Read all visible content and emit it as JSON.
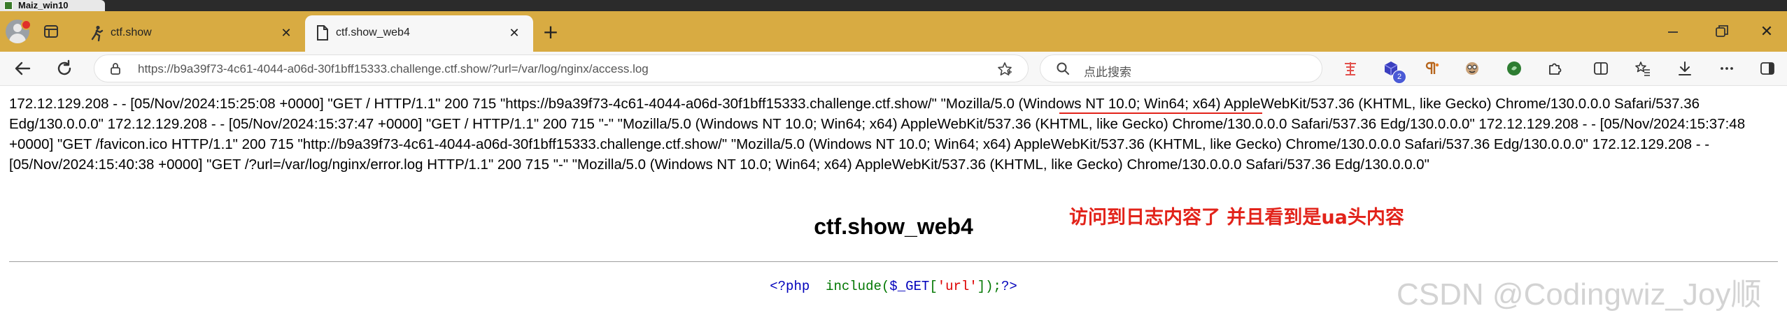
{
  "host_window": {
    "title": "Maiz_win10"
  },
  "browser": {
    "tabs": [
      {
        "label": "ctf.show",
        "favicon": "runner-icon",
        "active": false
      },
      {
        "label": "ctf.show_web4",
        "favicon": "document-icon",
        "active": true
      }
    ],
    "address_url": "https://b9a39f73-4c61-4044-a06d-30f1bff15333.challenge.ctf.show/?url=/var/log/nginx/access.log",
    "search_placeholder": "点此搜索",
    "extension_badge": "2",
    "colors": {
      "tab_bar": "#d8ab42",
      "toolbar": "#f7f7f7"
    }
  },
  "page": {
    "log_text": "172.12.129.208 - - [05/Nov/2024:15:25:08 +0000] \"GET / HTTP/1.1\" 200 715 \"https://b9a39f73-4c61-4044-a06d-30f1bff15333.challenge.ctf.show/\" \"Mozilla/5.0 (Windows NT 10.0; Win64; x64) AppleWebKit/537.36 (KHTML, like Gecko) Chrome/130.0.0.0 Safari/537.36 Edg/130.0.0.0\" 172.12.129.208 - - [05/Nov/2024:15:37:47 +0000] \"GET / HTTP/1.1\" 200 715 \"-\" \"Mozilla/5.0 (Windows NT 10.0; Win64; x64) AppleWebKit/537.36 (KHTML, like Gecko) Chrome/130.0.0.0 Safari/537.36 Edg/130.0.0.0\" 172.12.129.208 - - [05/Nov/2024:15:37:48 +0000] \"GET /favicon.ico HTTP/1.1\" 200 715 \"http://b9a39f73-4c61-4044-a06d-30f1bff15333.challenge.ctf.show/\" \"Mozilla/5.0 (Windows NT 10.0; Win64; x64) AppleWebKit/537.36 (KHTML, like Gecko) Chrome/130.0.0.0 Safari/537.36 Edg/130.0.0.0\" 172.12.129.208 - - [05/Nov/2024:15:40:38 +0000] \"GET /?url=/var/log/nginx/error.log HTTP/1.1\" 200 715 \"-\" \"Mozilla/5.0 (Windows NT 10.0; Win64; x64) AppleWebKit/537.36 (KHTML, like Gecko) Chrome/130.0.0.0 Safari/537.36 Edg/130.0.0.0\"",
    "heading": "ctf.show_web4",
    "annotation": "访问到日志内容了 并且看到是ua头内容",
    "code": {
      "open_tag": "<?php",
      "function": "include",
      "paren_open": "(",
      "variable": "$_GET",
      "bracket_open": "[",
      "key": "'url'",
      "bracket_close": "]",
      "paren_close": ")",
      "semicolon": ";",
      "close_tag": "?>"
    },
    "annotation_color": "#e2231a"
  },
  "watermark": "CSDN @Codingwiz_Joy顺"
}
